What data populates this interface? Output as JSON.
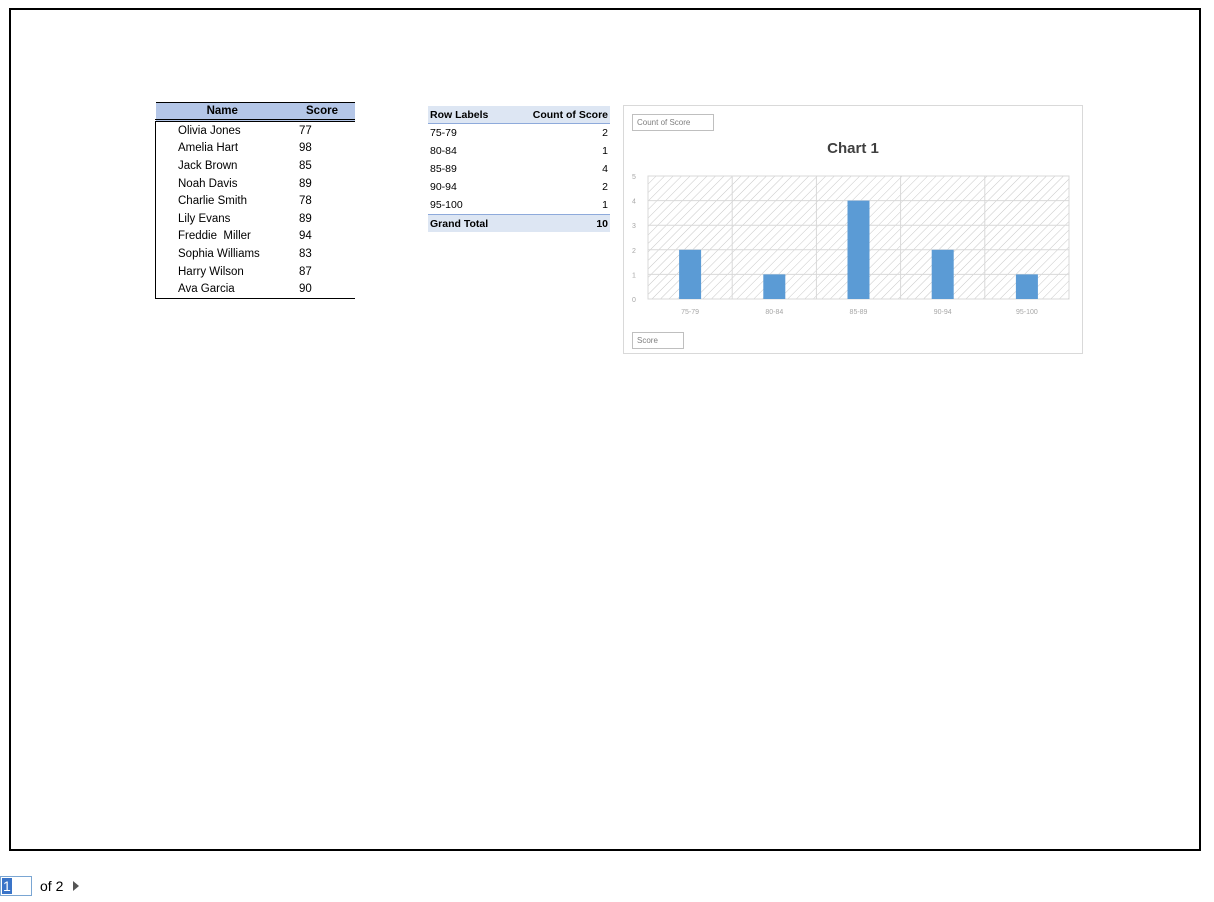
{
  "table": {
    "headers": [
      "Name",
      "Score"
    ],
    "rows": [
      {
        "name": "Olivia Jones",
        "score": "77"
      },
      {
        "name": "Amelia Hart",
        "score": "98"
      },
      {
        "name": "Jack Brown",
        "score": "85"
      },
      {
        "name": "Noah Davis",
        "score": "89"
      },
      {
        "name": "Charlie Smith",
        "score": "78"
      },
      {
        "name": "Lily Evans",
        "score": "89"
      },
      {
        "name": "Freddie  Miller",
        "score": "94"
      },
      {
        "name": "Sophia Williams",
        "score": "83"
      },
      {
        "name": "Harry Wilson",
        "score": "87"
      },
      {
        "name": "Ava Garcia",
        "score": "90"
      }
    ]
  },
  "pivot": {
    "headers": [
      "Row Labels",
      "Count of Score"
    ],
    "rows": [
      {
        "label": "75-79",
        "count": "2"
      },
      {
        "label": "80-84",
        "count": "1"
      },
      {
        "label": "85-89",
        "count": "4"
      },
      {
        "label": "90-94",
        "count": "2"
      },
      {
        "label": "95-100",
        "count": "1"
      }
    ],
    "total_label": "Grand Total",
    "total_value": "10"
  },
  "chart_data": {
    "type": "bar",
    "title": "Chart 1",
    "value_field_button": "Count of Score",
    "axis_field_button": "Score",
    "categories": [
      "75-79",
      "80-84",
      "85-89",
      "90-94",
      "95-100"
    ],
    "values": [
      2,
      1,
      4,
      2,
      1
    ],
    "ylim": [
      0,
      5
    ],
    "yticks": [
      0,
      1,
      2,
      3,
      4,
      5
    ],
    "grid": true,
    "bar_color": "#5b9bd5",
    "plot_background": "hatched"
  },
  "pager": {
    "current_page": "1",
    "of_label": "of 2"
  }
}
